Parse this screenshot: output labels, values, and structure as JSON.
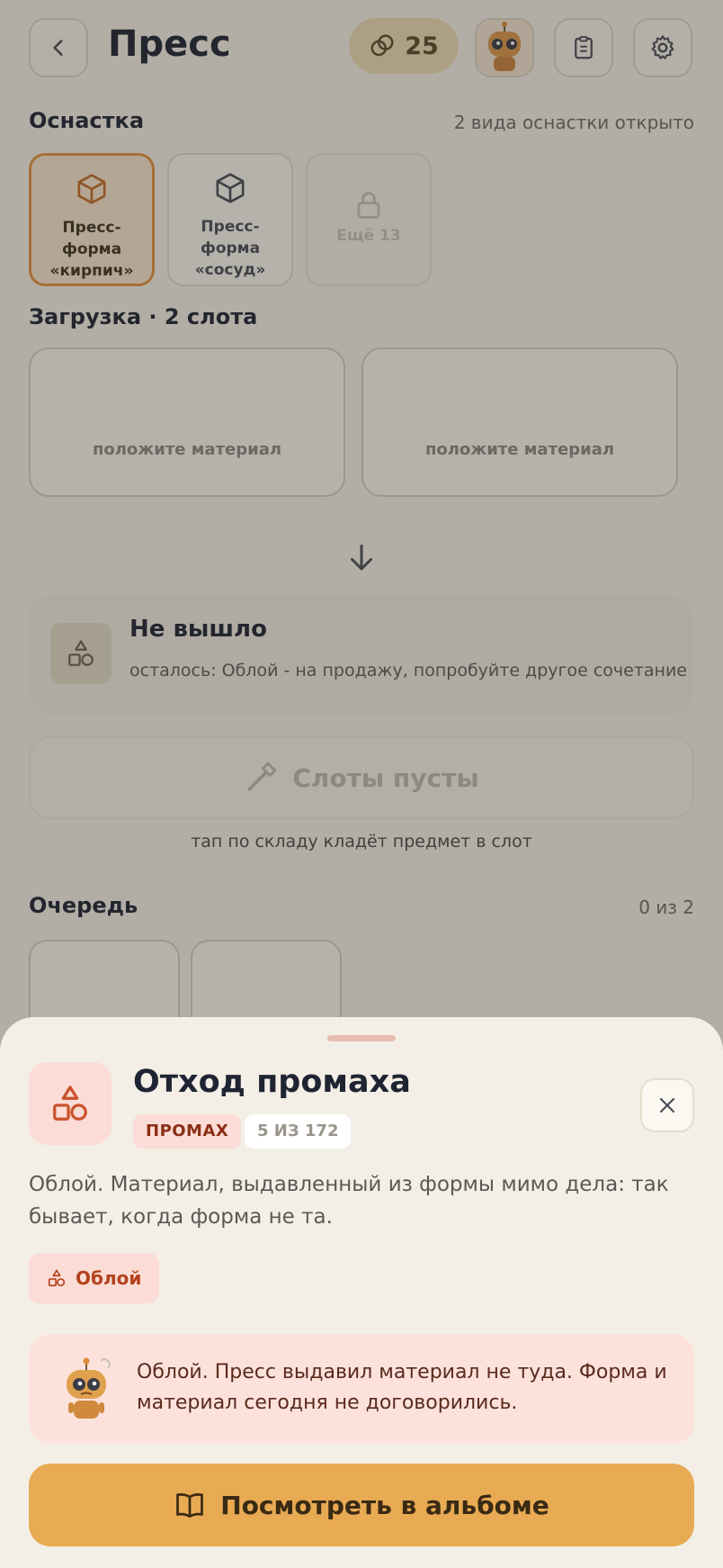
{
  "header": {
    "title": "Пресс",
    "coins": "25"
  },
  "tooling": {
    "title": "Оснастка",
    "note": "2 вида оснастки открыто",
    "items": [
      {
        "label": "Пресс-форма «кирпич»",
        "state": "selected",
        "icon": "cube-icon"
      },
      {
        "label": "Пресс-форма «сосуд»",
        "state": "available",
        "icon": "cube-icon"
      },
      {
        "label": "Ещё 13",
        "state": "locked",
        "icon": "lock-icon"
      }
    ]
  },
  "loading": {
    "title": "Загрузка · 2 слота",
    "slots": [
      {
        "hint": "положите материал"
      },
      {
        "hint": "положите материал"
      }
    ]
  },
  "result": {
    "title": "Не вышло",
    "text": "осталось: Облой - на продажу, попробуйте другое сочетание"
  },
  "run_button": {
    "label": "Слоты пусты"
  },
  "tap_note": "тап по складу кладёт предмет в слот",
  "queue": {
    "title": "Очередь",
    "count": "0 из 2"
  },
  "sheet": {
    "title": "Отход промаха",
    "badge": "ПРОМАХ",
    "count": "5 ИЗ 172",
    "description": "Облой. Материал, выдавленный из формы мимо дела: так бывает, когда форма не та.",
    "chip": "Облой",
    "quote": "Облой. Пресс выдавил материал не туда. Форма и материал сегодня не договорились.",
    "album_button": "Посмотреть в альбоме"
  },
  "colors": {
    "accent": "#e8aa52",
    "miss_bg": "#fbdcd6",
    "miss_text": "#b4421d",
    "selected_border": "#e0913e"
  }
}
